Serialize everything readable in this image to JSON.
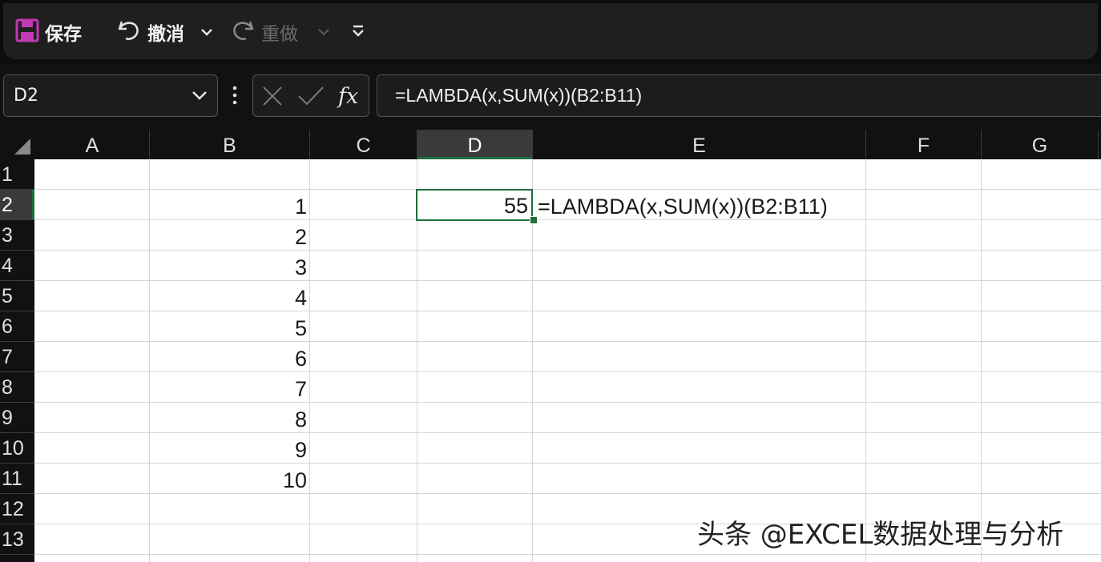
{
  "toolbar": {
    "save_label": "保存",
    "undo_label": "撤消",
    "redo_label": "重做"
  },
  "formula_bar": {
    "name_box": "D2",
    "formula": "=LAMBDA(x,SUM(x))(B2:B11)"
  },
  "columns": [
    "A",
    "B",
    "C",
    "D",
    "E",
    "F",
    "G"
  ],
  "selected_column": "D",
  "rows": [
    "1",
    "2",
    "3",
    "4",
    "5",
    "6",
    "7",
    "8",
    "9",
    "10",
    "11",
    "12",
    "13"
  ],
  "selected_row": "2",
  "cells": {
    "B": [
      "1",
      "2",
      "3",
      "4",
      "5",
      "6",
      "7",
      "8",
      "9",
      "10"
    ],
    "D2": "55",
    "E2": "=LAMBDA(x,SUM(x))(B2:B11)"
  },
  "watermark": "头条 @EXCEL数据处理与分析",
  "colors": {
    "accent": "#1e6f3d",
    "save_icon": "#c239b3"
  }
}
